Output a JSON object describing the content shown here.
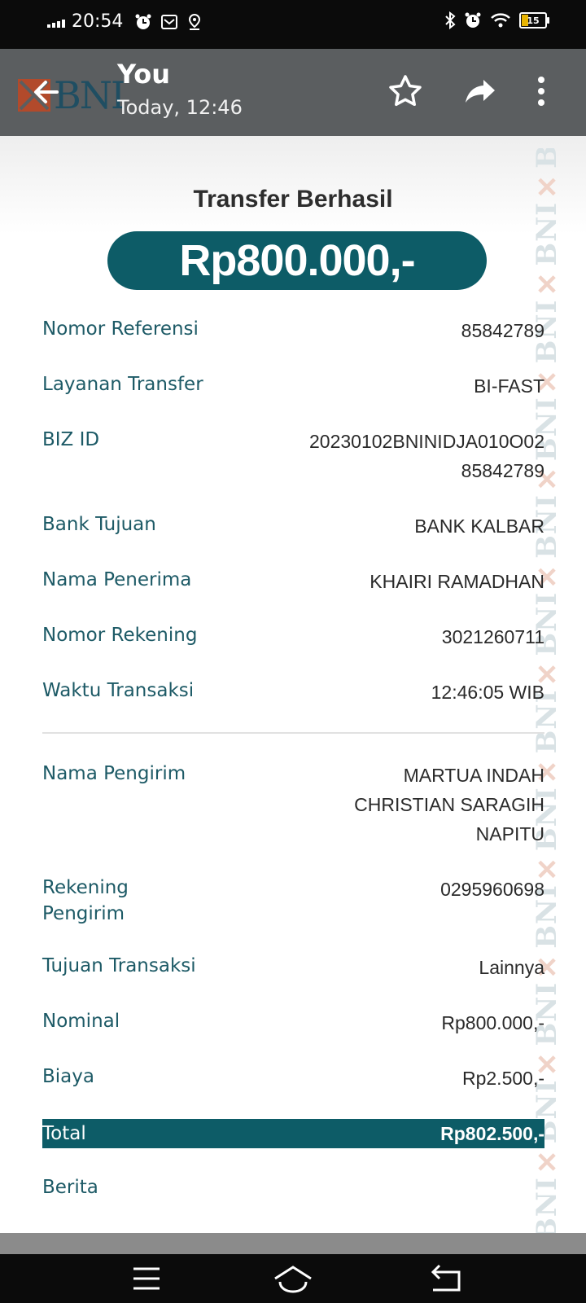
{
  "status_bar": {
    "time": "20:54",
    "battery_level": "15",
    "icons": [
      "signal-icon",
      "alarm-icon",
      "mail-icon",
      "location-icon",
      "bluetooth-icon",
      "alarm-icon",
      "wifi-icon",
      "battery-icon"
    ]
  },
  "app_bar": {
    "title": "You",
    "subtitle": "Today, 12:46",
    "background_logo": "BNI",
    "actions": [
      "back-icon",
      "star-icon",
      "share-icon",
      "more-icon"
    ]
  },
  "receipt": {
    "title": "Transfer Berhasil",
    "amount": "Rp800.000,-",
    "watermark": "BNI",
    "fields": [
      {
        "label": "Nomor Referensi",
        "value": "85842789"
      },
      {
        "label": "Layanan Transfer",
        "value": "BI-FAST"
      },
      {
        "label": "BIZ ID",
        "value_lines": [
          "20230102BNINIDJA010O02",
          "85842789"
        ]
      },
      {
        "label": "Bank Tujuan",
        "value": "BANK KALBAR"
      },
      {
        "label": "Nama Penerima",
        "value": "KHAIRI RAMADHAN"
      },
      {
        "label": "Nomor Rekening",
        "value": "3021260711"
      },
      {
        "label": "Waktu Transaksi",
        "value": "12:46:05 WIB"
      }
    ],
    "sender_fields": [
      {
        "label": "Nama Pengirim",
        "value_lines": [
          "MARTUA INDAH",
          "CHRISTIAN SARAGIH",
          "NAPITU"
        ]
      },
      {
        "label_lines": [
          "Rekening",
          "Pengirim"
        ],
        "value": "0295960698"
      },
      {
        "label": "Tujuan Transaksi",
        "value": "Lainnya"
      },
      {
        "label": "Nominal",
        "value": "Rp800.000,-"
      },
      {
        "label": "Biaya",
        "value": "Rp2.500,-"
      }
    ],
    "total": {
      "label": "Total",
      "value": "Rp802.500,-"
    },
    "note": {
      "label": "Berita",
      "value": ""
    }
  },
  "nav_bar": {
    "buttons": [
      "menu-icon",
      "home-icon",
      "back-icon"
    ]
  },
  "colors": {
    "accent": "#0d5c67",
    "label": "#1d5a66",
    "app_bar": "#5b5e60"
  }
}
